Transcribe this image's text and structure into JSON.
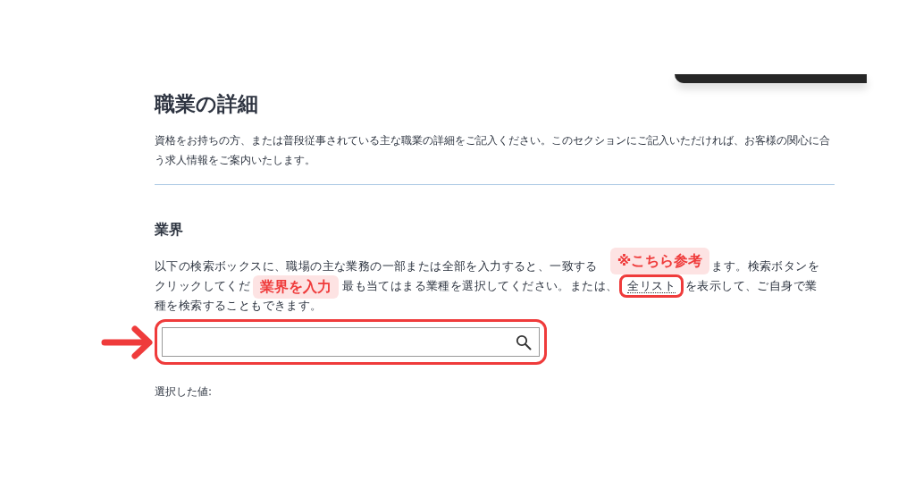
{
  "section": {
    "title": "職業の詳細",
    "description": "資格をお持ちの方、または普段従事されている主な職業の詳細をご記入ください。このセクションにご記入いただければ、お客様の関心に合う求人情報をご案内いたします。"
  },
  "industry": {
    "heading": "業界",
    "lines": [
      {
        "parts": [
          {
            "kind": "text",
            "text": "以下の検索ボックスに、職場の主な業務の一部または全部を入力すると、一致する"
          },
          {
            "kind": "label",
            "text": "※こちら参考"
          },
          {
            "kind": "text",
            "text": "ます。検索ボタンを"
          }
        ]
      },
      {
        "parts": [
          {
            "kind": "text",
            "text": "クリックしてくだ"
          },
          {
            "kind": "label",
            "text": "業界を入力"
          },
          {
            "kind": "text",
            "text": "最も当てはまる業種を選択してください。または、"
          },
          {
            "kind": "link",
            "text": "全リスト",
            "circled": true
          },
          {
            "kind": "text",
            "text": "を表示して、ご自身で業"
          }
        ]
      },
      {
        "parts": [
          {
            "kind": "text",
            "text": "種を検索することもできます。"
          }
        ]
      }
    ],
    "search": {
      "circled": true,
      "arrow": true
    },
    "selected_label": "選択した値:"
  }
}
